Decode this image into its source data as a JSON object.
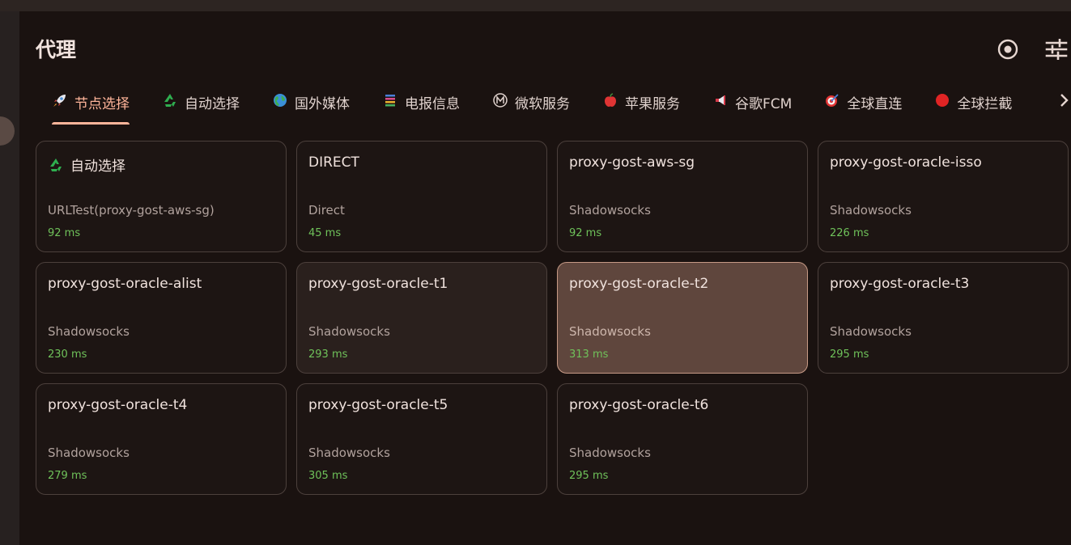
{
  "page": {
    "title": "代理"
  },
  "header": {
    "locate_icon": "target-icon",
    "settings_icon": "tune-sliders-icon"
  },
  "tabs": [
    {
      "label": "节点选择",
      "icon": "rocket-icon",
      "active": true
    },
    {
      "label": "自动选择",
      "icon": "recycle-icon"
    },
    {
      "label": "国外媒体",
      "icon": "globe-icon"
    },
    {
      "label": "电报信息",
      "icon": "telegram-icon"
    },
    {
      "label": "微软服务",
      "icon": "circled-m-icon"
    },
    {
      "label": "苹果服务",
      "icon": "apple-icon"
    },
    {
      "label": "谷歌FCM",
      "icon": "megaphone-icon"
    },
    {
      "label": "全球直连",
      "icon": "target-dart-icon"
    },
    {
      "label": "全球拦截",
      "icon": "red-circle-icon"
    }
  ],
  "proxies": [
    {
      "name": "自动选择",
      "type": "URLTest(proxy-gost-aws-sg)",
      "delay": "92 ms",
      "icon": "recycle-icon"
    },
    {
      "name": "DIRECT",
      "type": "Direct",
      "delay": "45 ms"
    },
    {
      "name": "proxy-gost-aws-sg",
      "type": "Shadowsocks",
      "delay": "92 ms"
    },
    {
      "name": "proxy-gost-oracle-isso",
      "type": "Shadowsocks",
      "delay": "226 ms"
    },
    {
      "name": "proxy-gost-oracle-alist",
      "type": "Shadowsocks",
      "delay": "230 ms"
    },
    {
      "name": "proxy-gost-oracle-t1",
      "type": "Shadowsocks",
      "delay": "293 ms"
    },
    {
      "name": "proxy-gost-oracle-t2",
      "type": "Shadowsocks",
      "delay": "313 ms",
      "selected": true
    },
    {
      "name": "proxy-gost-oracle-t3",
      "type": "Shadowsocks",
      "delay": "295 ms"
    },
    {
      "name": "proxy-gost-oracle-t4",
      "type": "Shadowsocks",
      "delay": "279 ms"
    },
    {
      "name": "proxy-gost-oracle-t5",
      "type": "Shadowsocks",
      "delay": "305 ms"
    },
    {
      "name": "proxy-gost-oracle-t6",
      "type": "Shadowsocks",
      "delay": "295 ms"
    }
  ],
  "colors": {
    "accent": "#ffb59a",
    "delay_good": "#6fc25a",
    "selected_card": "#5f463d",
    "background": "#1a1210"
  }
}
